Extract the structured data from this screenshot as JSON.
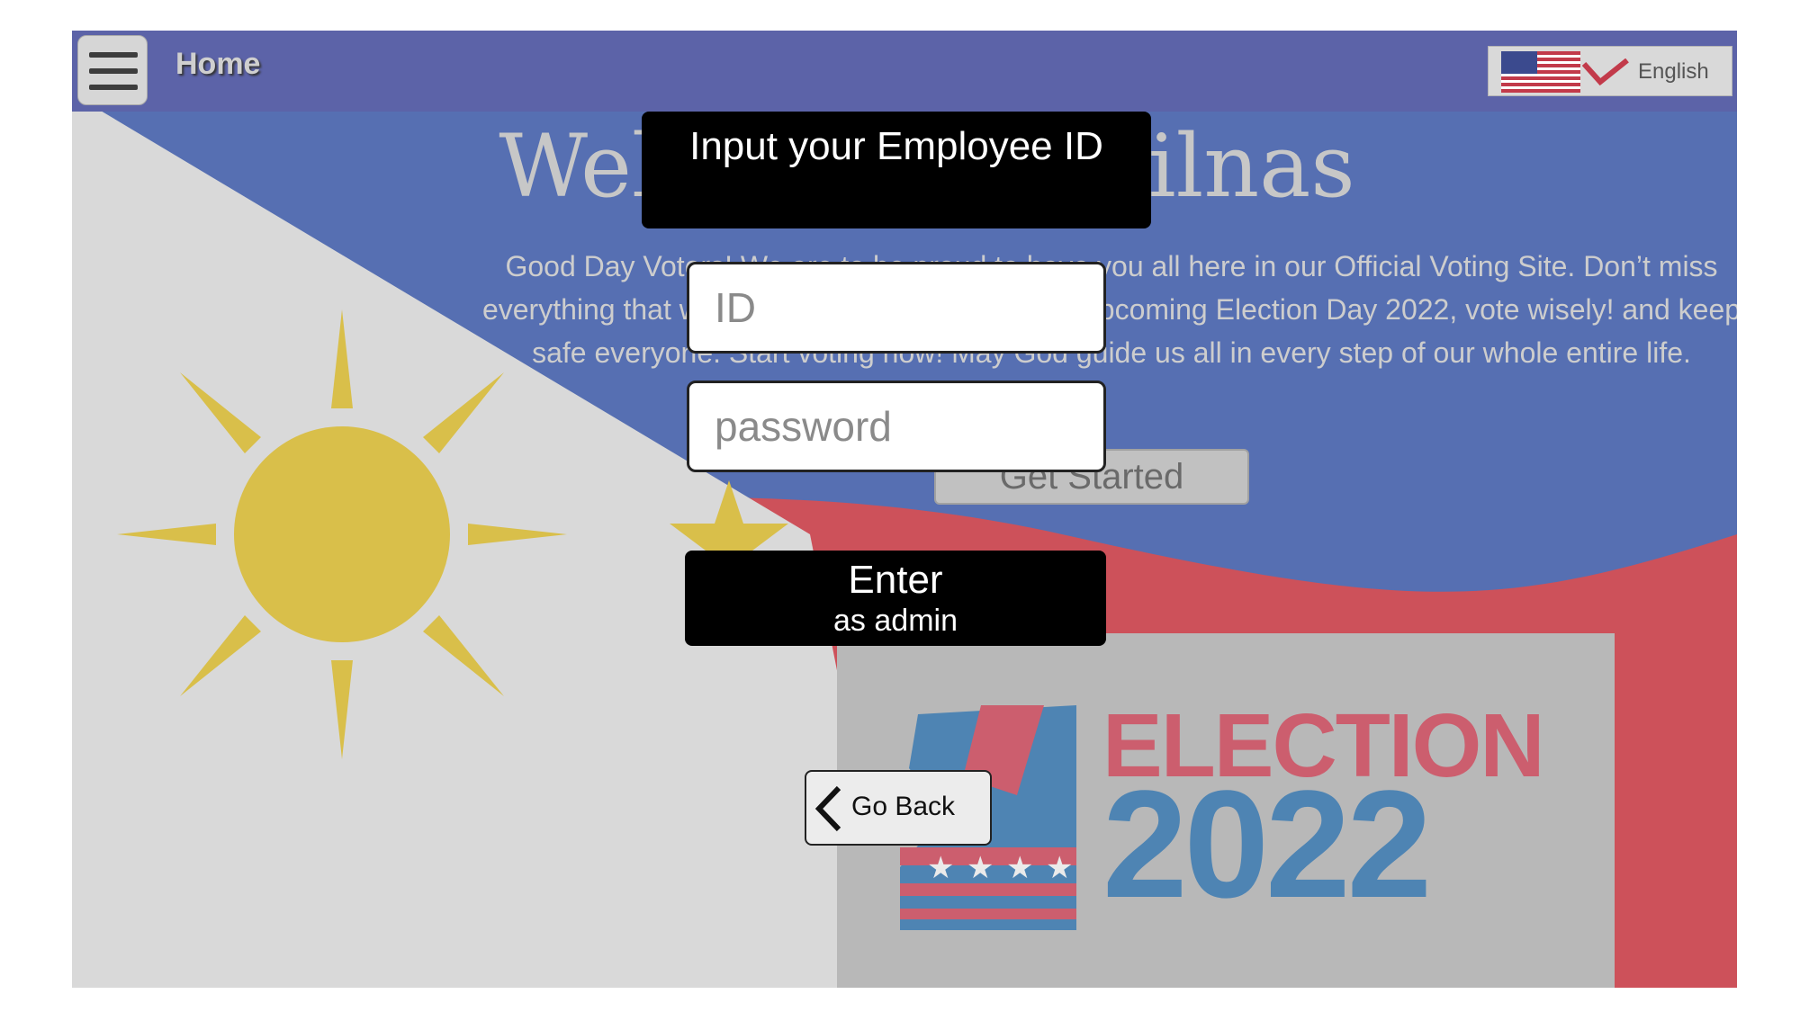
{
  "header": {
    "title": "Home",
    "language": {
      "label": "English",
      "flag_icon": "us-flag-icon"
    }
  },
  "welcome": {
    "heading": "Welcome to Philnas",
    "text": "Good Day Voters! We are to be proud to have you all here in our Official Voting Site. Don’t miss everything that we are preparing for you in this upcoming Election Day 2022, vote wisely! and keep safe everyone. Start voting now! May God guide us all in every step of our whole entire life.",
    "get_started_label": "Get Started"
  },
  "poster": {
    "line1": "ELECTION",
    "line2": "2022"
  },
  "modal": {
    "title": "Input your Employee ID",
    "id_placeholder": "ID",
    "password_placeholder": "password",
    "enter_label": "Enter",
    "enter_sublabel": "as admin",
    "go_back_label": "Go Back"
  },
  "colors": {
    "topbar": "#5c63a8",
    "flag_blue": "#3a5bb5",
    "flag_red": "#d9333f",
    "flag_white": "#e8e8e8",
    "sun_yellow": "#e8c62a",
    "modal_black": "#000000",
    "poster_red": "#d7445a",
    "poster_blue": "#2f77b6"
  }
}
